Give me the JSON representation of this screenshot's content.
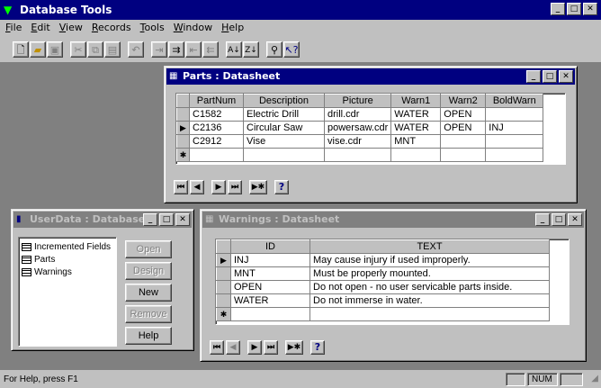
{
  "app": {
    "title": "Database Tools"
  },
  "menu": [
    "File",
    "Edit",
    "View",
    "Records",
    "Tools",
    "Window",
    "Help"
  ],
  "toolbar_icons": [
    "new-file-icon",
    "open-folder-icon",
    "save-icon",
    "cut-icon",
    "copy-icon",
    "paste-icon",
    "undo-icon",
    "insert-row-icon",
    "insert-col-icon",
    "delete-row-icon",
    "delete-col-icon",
    "sort-ascending-icon",
    "sort-descending-icon",
    "find-icon",
    "help-pointer-icon"
  ],
  "parts": {
    "title": "Parts : Datasheet",
    "columns": [
      "PartNum",
      "Description",
      "Picture",
      "Warn1",
      "Warn2",
      "BoldWarn"
    ],
    "rows": [
      [
        "C1582",
        "Electric Drill",
        "drill.cdr",
        "WATER",
        "OPEN",
        ""
      ],
      [
        "C2136",
        "Circular Saw",
        "powersaw.cdr",
        "WATER",
        "OPEN",
        "INJ"
      ],
      [
        "C2912",
        "Vise",
        "vise.cdr",
        "MNT",
        "",
        ""
      ]
    ],
    "current_row_marker": "▶",
    "new_row_marker": "✱"
  },
  "userdata": {
    "title": "UserData : Database",
    "objects": [
      "Incremented Fields",
      "Parts",
      "Warnings"
    ],
    "buttons": {
      "open": "Open",
      "design": "Design",
      "new": "New",
      "remove": "Remove",
      "help": "Help"
    }
  },
  "warnings": {
    "title": "Warnings : Datasheet",
    "columns": [
      "ID",
      "TEXT"
    ],
    "rows": [
      [
        "INJ",
        "May cause injury if used improperly."
      ],
      [
        "MNT",
        "Must be properly mounted."
      ],
      [
        "OPEN",
        "Do not open - no user servicable parts inside."
      ],
      [
        "WATER",
        "Do not immerse in water."
      ]
    ],
    "current_row_marker": "▶",
    "new_row_marker": "✱"
  },
  "nav": {
    "first": "⏮",
    "prev": "◀",
    "next": "▶",
    "last": "⏭",
    "new": "▶✱",
    "help": "?"
  },
  "status": {
    "text": "For Help, press F1",
    "num": "NUM"
  }
}
